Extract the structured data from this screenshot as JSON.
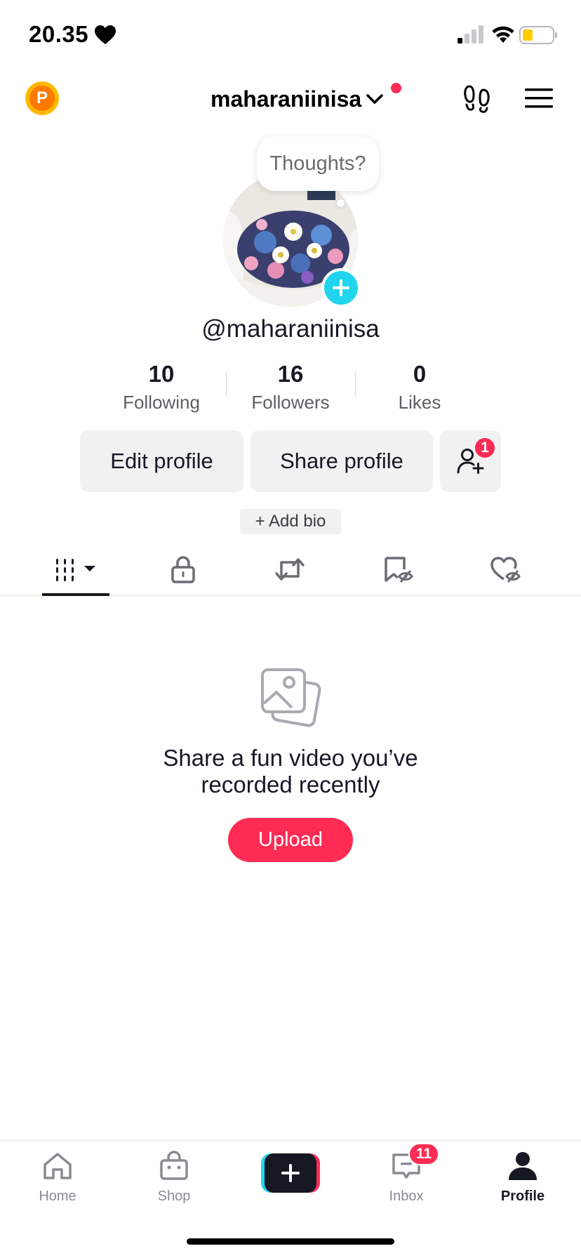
{
  "status_bar": {
    "time": "20.35",
    "icons": [
      "heart-icon",
      "signal-icon",
      "wifi-icon",
      "battery-icon"
    ],
    "battery_color": "#ffcc00"
  },
  "top_nav": {
    "coin_letter": "P",
    "username": "maharaniinisa",
    "notification_dot_color": "#fe2c55"
  },
  "profile": {
    "thought_bubble": "Thoughts?",
    "handle": "@maharaniinisa",
    "stats": [
      {
        "value": "10",
        "label": "Following"
      },
      {
        "value": "16",
        "label": "Followers"
      },
      {
        "value": "0",
        "label": "Likes"
      }
    ],
    "buttons": {
      "edit": "Edit profile",
      "share": "Share profile",
      "friend_badge": "1"
    },
    "add_bio": "+ Add bio"
  },
  "tabs": [
    {
      "name": "videos-grid",
      "icon": "grid-icon",
      "active": true
    },
    {
      "name": "private",
      "icon": "lock-icon",
      "active": false
    },
    {
      "name": "reposts",
      "icon": "repost-icon",
      "active": false
    },
    {
      "name": "favorites",
      "icon": "bookmark-hidden-icon",
      "active": false
    },
    {
      "name": "liked",
      "icon": "heart-hidden-icon",
      "active": false
    }
  ],
  "empty_state": {
    "line1": "Share a fun video you’ve",
    "line2": "recorded recently",
    "button": "Upload"
  },
  "bottom_nav": {
    "items": [
      {
        "label": "Home",
        "icon": "home-icon"
      },
      {
        "label": "Shop",
        "icon": "shop-icon"
      },
      {
        "label": "",
        "icon": "create-plus-icon"
      },
      {
        "label": "Inbox",
        "icon": "inbox-icon"
      },
      {
        "label": "Profile",
        "icon": "profile-icon"
      }
    ],
    "inbox_badge": "11"
  },
  "colors": {
    "accent": "#fe2c55",
    "cyan": "#20d5ec",
    "text": "#161823",
    "muted": "#8a8b91"
  }
}
